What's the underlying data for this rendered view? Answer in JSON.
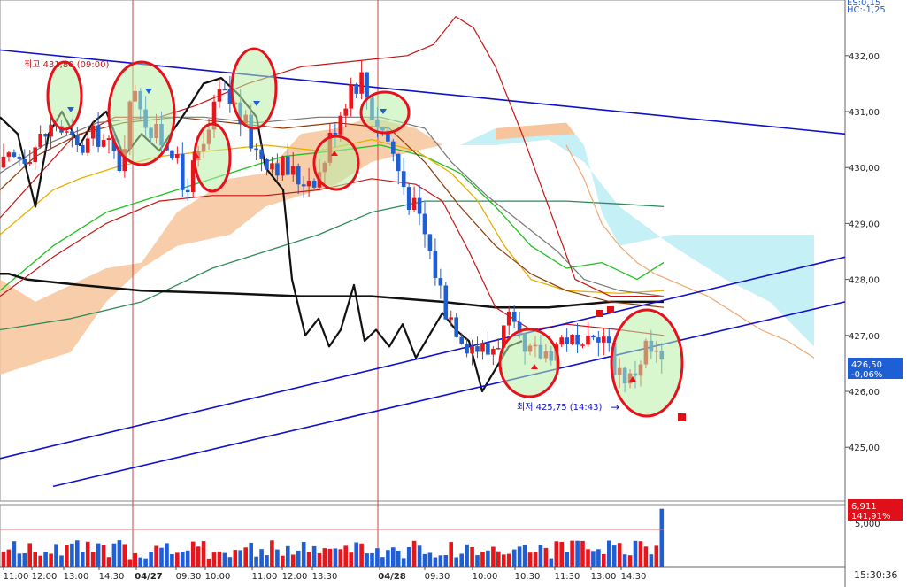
{
  "header": {
    "line1": "ES:0,15",
    "line2": "HC:-1,25"
  },
  "colors": {
    "up": "#e8161b",
    "down": "#1f5fd6",
    "trend": "#1010c8",
    "volume_tag": "#e0101a",
    "price_tag": "#1f5fd6",
    "cloud_bull": "#f7c49b",
    "cloud_bear": "#bfeef5",
    "ma_black": "#111111",
    "circle": "#e8101a"
  },
  "annotations": {
    "high_label": "최고 431,80 (09:00)",
    "low_label": "최저 425,75 (14:43)",
    "arrow": "→"
  },
  "tags": {
    "price": "426,50",
    "price_change": "-0,06%",
    "volume": "6,911",
    "volume_change": "141,91%",
    "volume_axis": "5,000"
  },
  "time_readout": "15:30:36",
  "chart_data": {
    "type": "candlestick",
    "price_axis": {
      "ylim": [
        424.3,
        433.0
      ],
      "ticks": [
        "432,00",
        "431,00",
        "430,00",
        "429,00",
        "428,00",
        "427,00",
        "426,00",
        "425,00"
      ]
    },
    "x_ticks": [
      {
        "label": "11:00",
        "bold": false
      },
      {
        "label": "12:00",
        "bold": false
      },
      {
        "label": "13:00",
        "bold": false
      },
      {
        "label": "14:30",
        "bold": false
      },
      {
        "label": "04/27",
        "bold": true
      },
      {
        "label": "09:30",
        "bold": false
      },
      {
        "label": "10:00",
        "bold": false
      },
      {
        "label": "11:00",
        "bold": false
      },
      {
        "label": "12:00",
        "bold": false
      },
      {
        "label": "13:30",
        "bold": false
      },
      {
        "label": "04/28",
        "bold": true
      },
      {
        "label": "09:30",
        "bold": false
      },
      {
        "label": "10:00",
        "bold": false
      },
      {
        "label": "10:30",
        "bold": false
      },
      {
        "label": "11:30",
        "bold": false
      },
      {
        "label": "13:00",
        "bold": false
      },
      {
        "label": "14:30",
        "bold": false
      }
    ],
    "series_keys": {
      "candles": "price candles (open, high, low, close)",
      "volume": "bar volume"
    }
  }
}
